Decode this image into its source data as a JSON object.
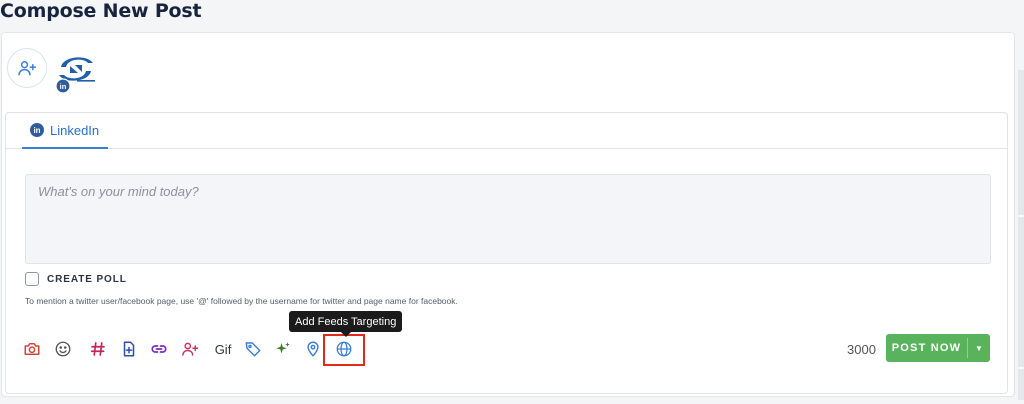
{
  "page": {
    "title": "Compose New Post"
  },
  "tabs": [
    {
      "label": "LinkedIn",
      "icon": "linkedin-icon"
    }
  ],
  "composer": {
    "placeholder": "What's on your mind today?",
    "value": ""
  },
  "poll": {
    "label": "CREATE POLL",
    "checked": false
  },
  "hint": "To mention a twitter user/facebook page, use '@' followed by the username for twitter and page name for facebook.",
  "toolbar": {
    "icons": [
      "camera-icon",
      "emoji-icon",
      "hashtag-icon",
      "document-add-icon",
      "link-icon",
      "add-user-icon",
      "gif-icon",
      "tag-icon",
      "sparkle-icon",
      "location-pin-icon",
      "globe-icon"
    ],
    "gif_label": "Gif",
    "tooltip": "Add Feeds Targeting"
  },
  "char_count": "3000",
  "post_button": {
    "label": "POST NOW"
  },
  "colors": {
    "accent": "#3b7fd6",
    "post_button": "#59b35c",
    "highlight": "#e02a1c",
    "title": "#18233d"
  }
}
